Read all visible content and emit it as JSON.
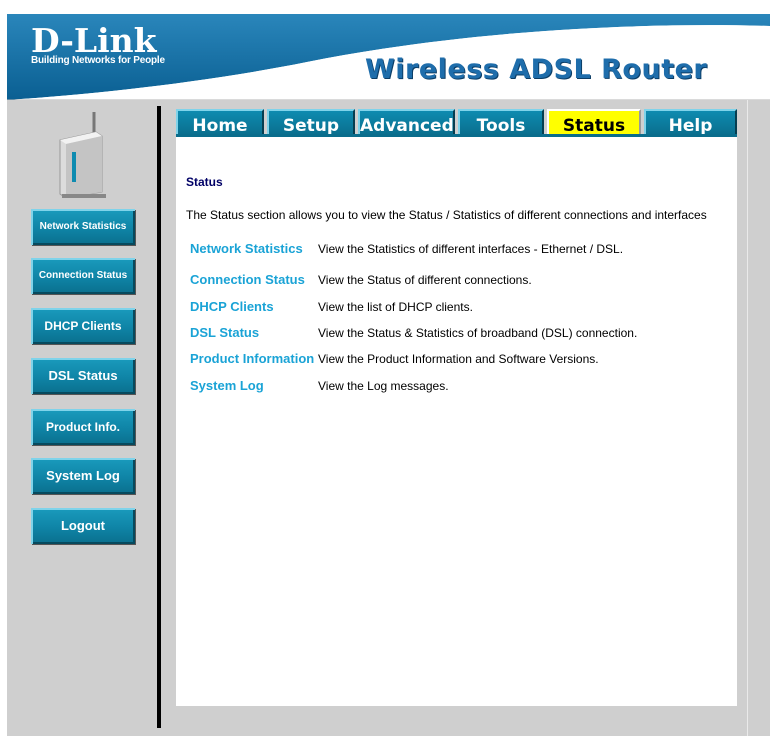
{
  "header": {
    "logo_main": "D-Link",
    "logo_tagline": "Building Networks for People",
    "product_title": "Wireless ADSL Router"
  },
  "tabs": [
    {
      "label": "Home",
      "active": false
    },
    {
      "label": "Setup",
      "active": false
    },
    {
      "label": "Advanced",
      "active": false
    },
    {
      "label": "Tools",
      "active": false
    },
    {
      "label": "Status",
      "active": true
    },
    {
      "label": "Help",
      "active": false
    }
  ],
  "sidebar": {
    "items": [
      {
        "label": "Network Statistics"
      },
      {
        "label": "Connection Status"
      },
      {
        "label": "DHCP Clients"
      },
      {
        "label": "DSL Status"
      },
      {
        "label": "Product Info."
      },
      {
        "label": "System Log"
      },
      {
        "label": "Logout"
      }
    ]
  },
  "content": {
    "title": "Status",
    "intro": "The Status section allows you to view the Status / Statistics of different connections and interfaces",
    "rows": [
      {
        "link": "Network Statistics",
        "desc": "View the Statistics of different interfaces - Ethernet / DSL."
      },
      {
        "link": "Connection Status",
        "desc": "View the Status of different connections."
      },
      {
        "link": "DHCP Clients",
        "desc": "View the list of DHCP clients."
      },
      {
        "link": "DSL Status",
        "desc": "View the Status & Statistics of broadband (DSL) connection."
      },
      {
        "link": "Product Information",
        "desc": "View the Product Information and Software Versions."
      },
      {
        "link": "System Log",
        "desc": "View the Log messages."
      }
    ]
  },
  "colors": {
    "header_blue": "#0f6fa0",
    "tab_blue": "#0e8bb0",
    "tab_active": "#ffff00",
    "link_cyan": "#1aa3d6",
    "frame_gray": "#cfcfcf"
  }
}
